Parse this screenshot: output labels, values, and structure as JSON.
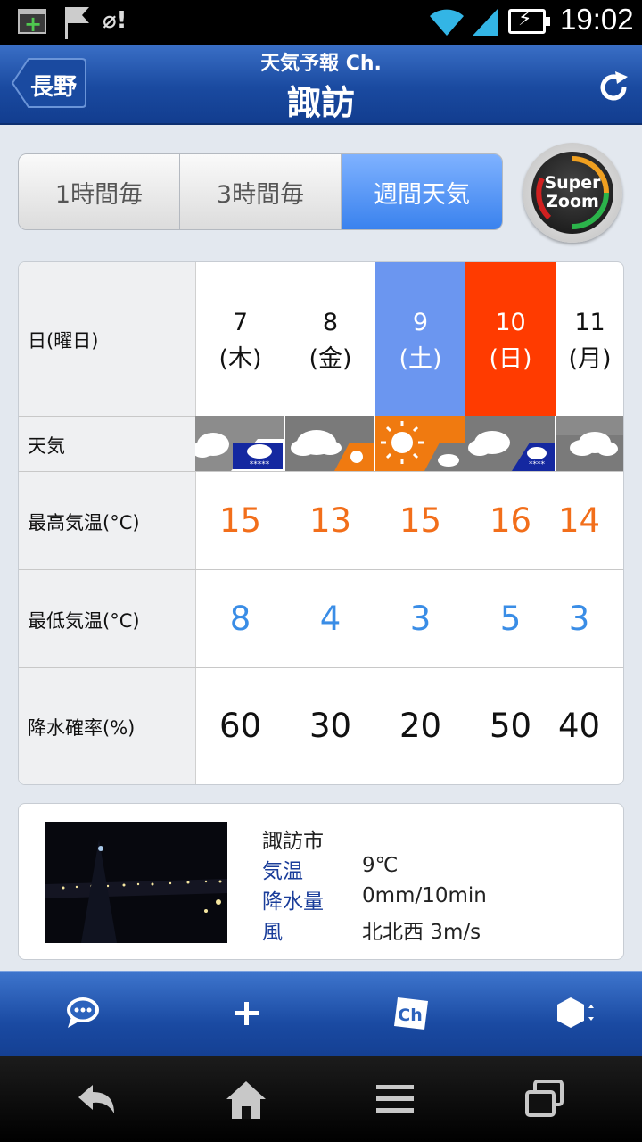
{
  "status_bar": {
    "time": "19:02",
    "icons": [
      "add-app-icon",
      "flag-icon",
      "leaf-alert-icon",
      "wifi-icon",
      "signal-icon",
      "battery-charging-icon"
    ]
  },
  "header": {
    "back_label": "長野",
    "app_title": "天気予報 Ch.",
    "city": "諏訪"
  },
  "tabs": [
    {
      "label": "1時間毎",
      "active": false
    },
    {
      "label": "3時間毎",
      "active": false
    },
    {
      "label": "週間天気",
      "active": true
    }
  ],
  "zoom_button": {
    "line1": "Super",
    "line2": "Zoom"
  },
  "forecast": {
    "row_labels": {
      "day": "日(曜日)",
      "weather": "天気",
      "high": "最高気温(°C)",
      "low": "最低気温(°C)",
      "precip": "降水確率(%)"
    },
    "days": [
      {
        "date": "7",
        "weekday": "(木)",
        "weather": "cloudy-then-snow",
        "high": "15",
        "low": "8",
        "precip": "60"
      },
      {
        "date": "8",
        "weekday": "(金)",
        "weather": "cloudy-then-sunny",
        "high": "13",
        "low": "4",
        "precip": "30"
      },
      {
        "date": "9",
        "weekday": "(土)",
        "weather": "sunny-then-cloudy",
        "high": "15",
        "low": "3",
        "precip": "20"
      },
      {
        "date": "10",
        "weekday": "(日)",
        "weather": "cloudy-then-snow",
        "high": "16",
        "low": "5",
        "precip": "50"
      },
      {
        "date": "11",
        "weekday": "(月)",
        "weather": "cloudy",
        "high": "14",
        "low": "3",
        "precip": "40"
      }
    ]
  },
  "current": {
    "city": "諏訪市",
    "rows": [
      {
        "key": "気温",
        "value": "9℃"
      },
      {
        "key": "降水量",
        "value": "0mm/10min"
      },
      {
        "key": "風",
        "value": "北北西 3m/s"
      }
    ]
  },
  "bottom_bar": [
    "chat-icon",
    "plus-icon",
    "channel-icon",
    "settings-hexagon-icon"
  ],
  "nav_bar": [
    "back-icon",
    "home-icon",
    "menu-icon",
    "recent-apps-icon"
  ]
}
